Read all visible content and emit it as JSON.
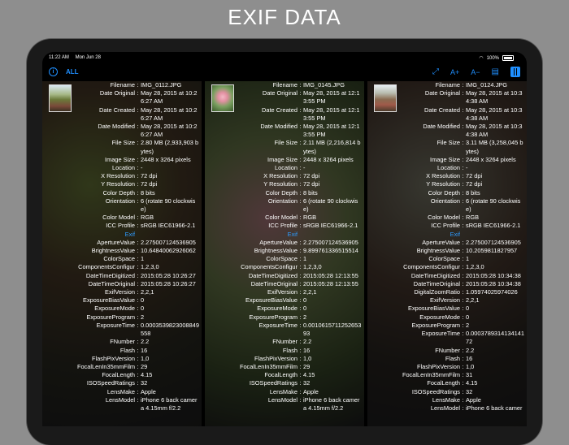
{
  "headline": "EXIF DATA",
  "status": {
    "time": "11:22 AM",
    "date": "Mon Jun 28",
    "battery": "100%",
    "battery_level": 1.0
  },
  "toolbar": {
    "all_label": "ALL",
    "font_up_label": "A+",
    "font_down_label": "A−"
  },
  "colors": {
    "accent": "#1f8fff",
    "section": "#2e9bff"
  },
  "panels": [
    {
      "rows": [
        {
          "k": "Filename",
          "v": "IMG_0112.JPG"
        },
        {
          "k": "Date Original",
          "v": "May 28, 2015 at 10:2 6:27 AM"
        },
        {
          "k": "Date Created",
          "v": "May 28, 2015 at 10:2 6:27 AM"
        },
        {
          "k": "Date Modified",
          "v": "May 28, 2015 at 10:2 6:27 AM"
        },
        {
          "k": "File Size",
          "v": "2.80 MB (2,933,903 b ytes)"
        },
        {
          "k": "Image Size",
          "v": "2448 x 3264 pixels"
        },
        {
          "k": "Location",
          "v": "-"
        },
        {
          "k": "X Resolution",
          "v": "72 dpi"
        },
        {
          "k": "Y Resolution",
          "v": "72 dpi"
        },
        {
          "k": "Color Depth",
          "v": "8 bits"
        },
        {
          "k": "Orientation",
          "v": "6 (rotate 90 clockwis e)"
        },
        {
          "k": "Color Model",
          "v": "RGB"
        },
        {
          "k": "ICC Profile",
          "v": "sRGB IEC61966-2.1"
        },
        {
          "section": "Exif"
        },
        {
          "k": "ApertureValue",
          "v": "2.275007124536905"
        },
        {
          "k": "BrightnessValue",
          "v": "10.64840062926062"
        },
        {
          "k": "ColorSpace",
          "v": "1"
        },
        {
          "k": "ComponentsConfigur",
          "v": "1,2,3,0"
        },
        {
          "k": "DateTimeDigitized",
          "v": "2015:05:28 10:26:27"
        },
        {
          "k": "DateTimeOriginal",
          "v": "2015:05:28 10:26:27"
        },
        {
          "k": "ExifVersion",
          "v": "2,2,1"
        },
        {
          "k": "ExposureBiasValue",
          "v": "0"
        },
        {
          "k": "ExposureMode",
          "v": "0"
        },
        {
          "k": "ExposureProgram",
          "v": "2"
        },
        {
          "k": "ExposureTime",
          "v": "0.0003539823008849 558"
        },
        {
          "k": "FNumber",
          "v": "2.2"
        },
        {
          "k": "Flash",
          "v": "16"
        },
        {
          "k": "FlashPixVersion",
          "v": "1,0"
        },
        {
          "k": "FocalLenIn35mmFilm",
          "v": "29"
        },
        {
          "k": "FocalLength",
          "v": "4.15"
        },
        {
          "k": "ISOSpeedRatings",
          "v": "32"
        },
        {
          "k": "LensMake",
          "v": "Apple"
        },
        {
          "k": "LensModel",
          "v": "iPhone 6 back camer a 4.15mm f/2.2"
        }
      ]
    },
    {
      "rows": [
        {
          "k": "Filename",
          "v": "IMG_0145.JPG"
        },
        {
          "k": "Date Original",
          "v": "May 28, 2015 at 12:1 3:55 PM"
        },
        {
          "k": "Date Created",
          "v": "May 28, 2015 at 12:1 3:55 PM"
        },
        {
          "k": "Date Modified",
          "v": "May 28, 2015 at 12:1 3:55 PM"
        },
        {
          "k": "File Size",
          "v": "2.11 MB (2,216,814 b ytes)"
        },
        {
          "k": "Image Size",
          "v": "2448 x 3264 pixels"
        },
        {
          "k": "Location",
          "v": "-"
        },
        {
          "k": "X Resolution",
          "v": "72 dpi"
        },
        {
          "k": "Y Resolution",
          "v": "72 dpi"
        },
        {
          "k": "Color Depth",
          "v": "8 bits"
        },
        {
          "k": "Orientation",
          "v": "6 (rotate 90 clockwis e)"
        },
        {
          "k": "Color Model",
          "v": "RGB"
        },
        {
          "k": "ICC Profile",
          "v": "sRGB IEC61966-2.1"
        },
        {
          "section": "Exif"
        },
        {
          "k": "ApertureValue",
          "v": "2.275007124536905"
        },
        {
          "k": "BrightnessValue",
          "v": "9.899761336515514"
        },
        {
          "k": "ColorSpace",
          "v": "1"
        },
        {
          "k": "ComponentsConfigur",
          "v": "1,2,3,0"
        },
        {
          "k": "DateTimeDigitized",
          "v": "2015:05:28 12:13:55"
        },
        {
          "k": "DateTimeOriginal",
          "v": "2015:05:28 12:13:55"
        },
        {
          "k": "ExifVersion",
          "v": "2,2,1"
        },
        {
          "k": "ExposureBiasValue",
          "v": "0"
        },
        {
          "k": "ExposureMode",
          "v": "0"
        },
        {
          "k": "ExposureProgram",
          "v": "2"
        },
        {
          "k": "ExposureTime",
          "v": "0.0010615711252653 93"
        },
        {
          "k": "FNumber",
          "v": "2.2"
        },
        {
          "k": "Flash",
          "v": "16"
        },
        {
          "k": "FlashPixVersion",
          "v": "1,0"
        },
        {
          "k": "FocalLenIn35mmFilm",
          "v": "29"
        },
        {
          "k": "FocalLength",
          "v": "4.15"
        },
        {
          "k": "ISOSpeedRatings",
          "v": "32"
        },
        {
          "k": "LensMake",
          "v": "Apple"
        },
        {
          "k": "LensModel",
          "v": "iPhone 6 back camer a 4.15mm f/2.2"
        }
      ]
    },
    {
      "rows": [
        {
          "k": "Filename",
          "v": "IMG_0124.JPG"
        },
        {
          "k": "Date Original",
          "v": "May 28, 2015 at 10:3 4:38 AM"
        },
        {
          "k": "Date Created",
          "v": "May 28, 2015 at 10:3 4:38 AM"
        },
        {
          "k": "Date Modified",
          "v": "May 28, 2015 at 10:3 4:38 AM"
        },
        {
          "k": "File Size",
          "v": "3.11 MB (3,258,045 b ytes)"
        },
        {
          "k": "Image Size",
          "v": "2448 x 3264 pixels"
        },
        {
          "k": "Location",
          "v": "-"
        },
        {
          "k": "X Resolution",
          "v": "72 dpi"
        },
        {
          "k": "Y Resolution",
          "v": "72 dpi"
        },
        {
          "k": "Color Depth",
          "v": "8 bits"
        },
        {
          "k": "Orientation",
          "v": "6 (rotate 90 clockwis e)"
        },
        {
          "k": "Color Model",
          "v": "RGB"
        },
        {
          "k": "ICC Profile",
          "v": "sRGB IEC61966-2.1"
        },
        {
          "section": "Exif"
        },
        {
          "k": "ApertureValue",
          "v": "2.275007124536905"
        },
        {
          "k": "BrightnessValue",
          "v": "10.2059811827957"
        },
        {
          "k": "ColorSpace",
          "v": "1"
        },
        {
          "k": "ComponentsConfigur",
          "v": "1,2,3,0"
        },
        {
          "k": "DateTimeDigitized",
          "v": "2015:05:28 10:34:38"
        },
        {
          "k": "DateTimeOriginal",
          "v": "2015:05:28 10:34:38"
        },
        {
          "k": "DigitalZoomRatio",
          "v": "1.05974025974026"
        },
        {
          "k": "ExifVersion",
          "v": "2,2,1"
        },
        {
          "k": "ExposureBiasValue",
          "v": "0"
        },
        {
          "k": "ExposureMode",
          "v": "0"
        },
        {
          "k": "ExposureProgram",
          "v": "2"
        },
        {
          "k": "ExposureTime",
          "v": "0.0003789314134141 72"
        },
        {
          "k": "FNumber",
          "v": "2.2"
        },
        {
          "k": "Flash",
          "v": "16"
        },
        {
          "k": "FlashPixVersion",
          "v": "1,0"
        },
        {
          "k": "FocalLenIn35mmFilm",
          "v": "31"
        },
        {
          "k": "FocalLength",
          "v": "4.15"
        },
        {
          "k": "ISOSpeedRatings",
          "v": "32"
        },
        {
          "k": "LensMake",
          "v": "Apple"
        },
        {
          "k": "LensModel",
          "v": "iPhone 6 back camer"
        }
      ]
    }
  ]
}
